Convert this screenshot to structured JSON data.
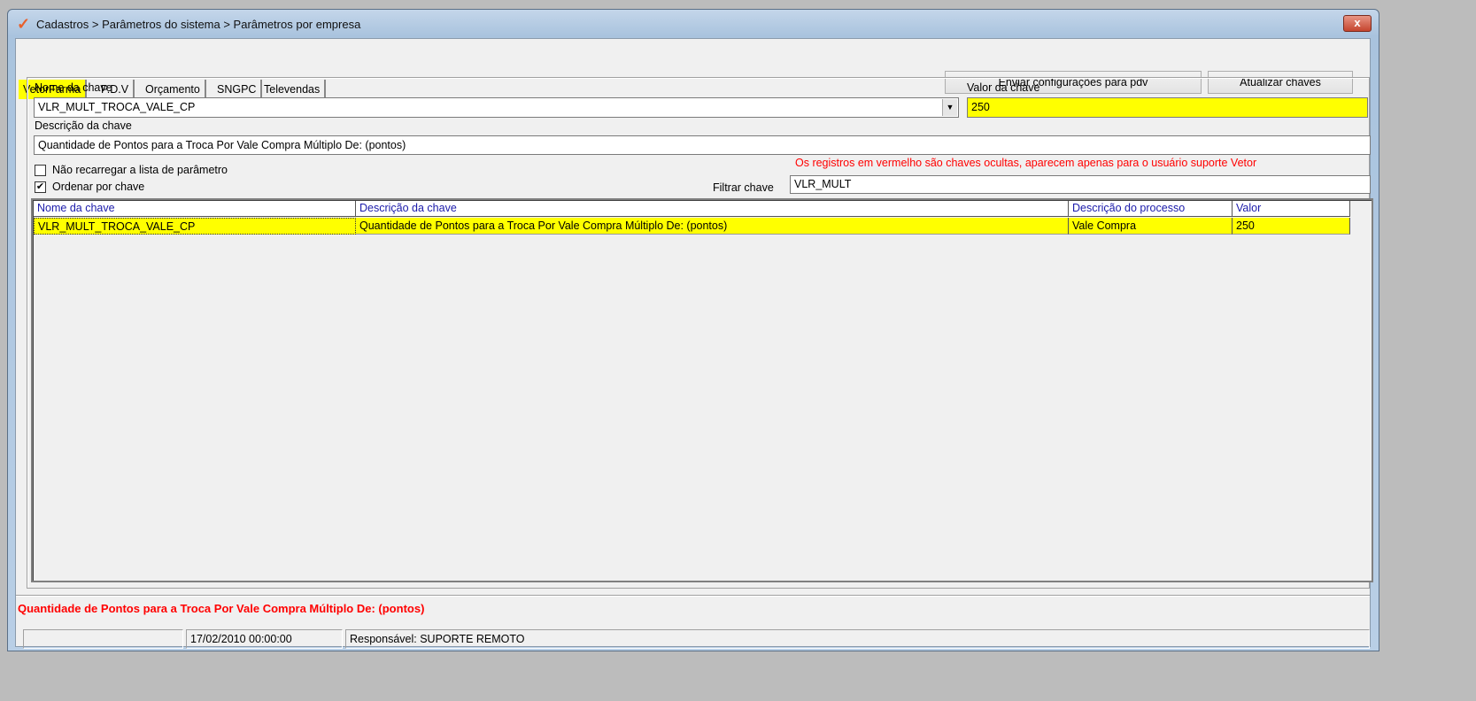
{
  "window": {
    "title": "Cadastros > Parâmetros do sistema > Parâmetros por empresa",
    "close": "x"
  },
  "tabs": [
    "VetorFarma",
    "P.D.V",
    "Orçamento",
    "SNGPC",
    "Televendas"
  ],
  "buttons": {
    "send": "Enviar configurações para  pdv",
    "refresh": "Atualizar chaves"
  },
  "form": {
    "key_name_label": "Nome da chave",
    "key_name_value": "VLR_MULT_TROCA_VALE_CP",
    "key_value_label": "Valor da chave",
    "key_value": "250",
    "desc_label": "Descrição da chave",
    "desc_value": "Quantidade de Pontos para a Troca Por Vale Compra Múltiplo De: (pontos)",
    "no_reload_label": "Não recarregar a lista de parâmetro",
    "no_reload_checked": false,
    "order_label": "Ordenar por chave",
    "order_checked": true,
    "hidden_note": "Os registros em vermelho são chaves ocultas, aparecem apenas para o usuário suporte Vetor",
    "filter_label": "Filtrar chave",
    "filter_value": "VLR_MULT"
  },
  "grid": {
    "headers": [
      "Nome da chave",
      "Descrição  da chave",
      "Descrição do processo",
      "Valor"
    ],
    "rows": [
      [
        "VLR_MULT_TROCA_VALE_CP",
        "Quantidade de Pontos para a Troca Por Vale Compra Múltiplo De: (pontos)",
        "Vale Compra",
        "250"
      ]
    ]
  },
  "footer_desc": "Quantidade de Pontos para a Troca Por Vale Compra Múltiplo De: (pontos)",
  "status": {
    "panel1": "",
    "date": "17/02/2010 00:00:00",
    "responsible": "Responsável: SUPORTE REMOTO"
  },
  "colors": {
    "highlight": "#ffff00",
    "warning": "#ff0000",
    "header_text": "#1a1aaa"
  }
}
